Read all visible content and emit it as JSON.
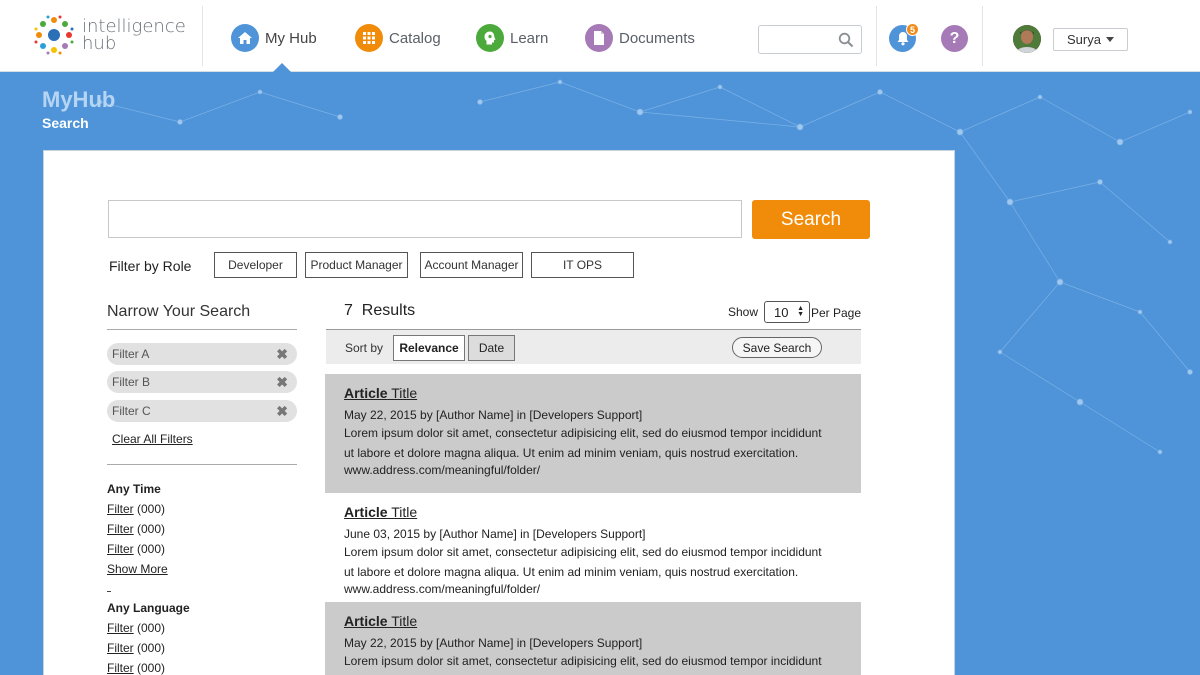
{
  "brand": {
    "line1": "intelligence",
    "line2": "hub"
  },
  "nav": [
    {
      "label": "My Hub",
      "icon": "home-icon",
      "color": "#4f94d9"
    },
    {
      "label": "Catalog",
      "icon": "grid-icon",
      "color": "#f08c09"
    },
    {
      "label": "Learn",
      "icon": "learn-icon",
      "color": "#4caa3c"
    },
    {
      "label": "Documents",
      "icon": "document-icon",
      "color": "#a67ab6"
    }
  ],
  "header": {
    "search_placeholder": "",
    "notification_count": "5",
    "help_label": "?",
    "user_name": "Surya"
  },
  "page": {
    "title": "MyHub",
    "subtitle": "Search"
  },
  "search": {
    "value": "",
    "button_label": "Search"
  },
  "role_filter": {
    "label": "Filter by Role",
    "roles": [
      "Developer",
      "Product Manager",
      "Account Manager",
      "IT OPS"
    ]
  },
  "sidebar": {
    "title": "Narrow Your Search",
    "active_filters": [
      "Filter A",
      "Filter B",
      "Filter C"
    ],
    "clear_all_label": "Clear All Filters",
    "facets": [
      {
        "title": "Any Time",
        "items": [
          {
            "label": "Filter",
            "count": "(000)"
          },
          {
            "label": "Filter",
            "count": "(000)"
          },
          {
            "label": "Filter",
            "count": "(000)"
          }
        ],
        "show_more": "Show More"
      },
      {
        "title": "Any Language",
        "items": [
          {
            "label": "Filter",
            "count": "(000)"
          },
          {
            "label": "Filter",
            "count": "(000)"
          },
          {
            "label": "Filter",
            "count": "(000)"
          }
        ]
      }
    ]
  },
  "results": {
    "count": "7",
    "count_label": "Results",
    "show_label": "Show",
    "per_page_value": "10",
    "per_page_label": "Per Page",
    "sort_label": "Sort by",
    "sort_options": [
      "Relevance",
      "Date"
    ],
    "save_search_label": "Save Search",
    "items": [
      {
        "title_bold": "Article",
        "title_rest": " Title",
        "meta": "May 22, 2015 by [Author Name] in [Developers Support]",
        "body": "Lorem ipsum dolor sit amet, consectetur adipisicing elit, sed do eiusmod tempor incididunt ut labore et dolore magna aliqua. Ut enim ad minim veniam, quis nostrud exercitation.",
        "url": "www.address.com/meaningful/folder/"
      },
      {
        "title_bold": "Article",
        "title_rest": " Title",
        "meta": "June 03, 2015 by [Author Name] in [Developers Support]",
        "body": "Lorem ipsum dolor sit amet, consectetur adipisicing elit, sed do eiusmod tempor incididunt ut labore et dolore magna aliqua. Ut enim ad minim veniam, quis nostrud exercitation.",
        "url": "www.address.com/meaningful/folder/"
      },
      {
        "title_bold": "Article",
        "title_rest": " Title",
        "meta": "May 22, 2015 by [Author Name] in [Developers Support]",
        "body": "Lorem ipsum dolor sit amet, consectetur adipisicing elit, sed do eiusmod tempor incididunt",
        "url": ""
      }
    ]
  },
  "colors": {
    "banner": "#4f94d9",
    "accent_orange": "#f08c09",
    "result_shade": "#cbcbcb"
  }
}
